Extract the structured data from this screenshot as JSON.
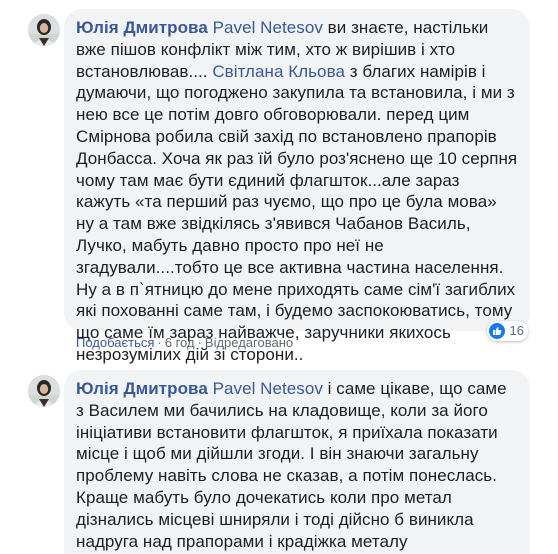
{
  "comments": [
    {
      "author": "Юлія Дмитрова",
      "parts": [
        {
          "type": "mention",
          "text": "Pavel Netesov"
        },
        {
          "type": "text",
          "text": " ви знаєте, настільки вже пішов конфлікт між тим, хто ж вирішив і хто встановлював.... "
        },
        {
          "type": "mention",
          "text": "Світлана Кльова"
        },
        {
          "type": "text",
          "text": " з благих намірів і думаючи, що погоджено закупила та встановила, і ми з нею все це потім довго обговорювали. перед цим Смірнова робила свій захід по встановлено прапорів Донбасса. Хоча як раз їй було роз'яснено ще 10 серпня чому там має бути єдиний флагшток...але зараз кажуть «та перший раз чуємо, що про це була мова» ну а там вже звідкілясь з'явився Чабанов Василь, Лучко, мабуть давно просто про неї не згадували....тобто це все активна частина населення. Ну а в п`ятницю до мене приходять саме сім'ї загиблих які похованні саме там, і будемо заспокоюватись, тому що саме їм зараз найважче, заручники якихось незрозумілих дій зі сторони.."
        }
      ],
      "reaction_count": "16",
      "actions": {
        "like": "Подобається",
        "time": "6 год",
        "edited": "Відредаговано"
      }
    },
    {
      "author": "Юлія Дмитрова",
      "parts": [
        {
          "type": "mention",
          "text": "Pavel Netesov"
        },
        {
          "type": "text",
          "text": " і саме цікаве, що саме з Василем ми бачились на кладовище, коли за його ініціативи встановити флагшток, я приїхала показати місце і щоб ми дійшли згоди. І він знаючи загальну проблему навіть слова не сказав, а потім понеслась. Краще мабуть було дочекатись коли про метал дізнались місцеві шниряли і тоді дійсно б виникла надруга над прапорами і крадіжка металу"
        }
      ]
    }
  ],
  "colors": {
    "link": "#385898",
    "bubble": "#f2f3f5",
    "like": "#1877f2"
  }
}
